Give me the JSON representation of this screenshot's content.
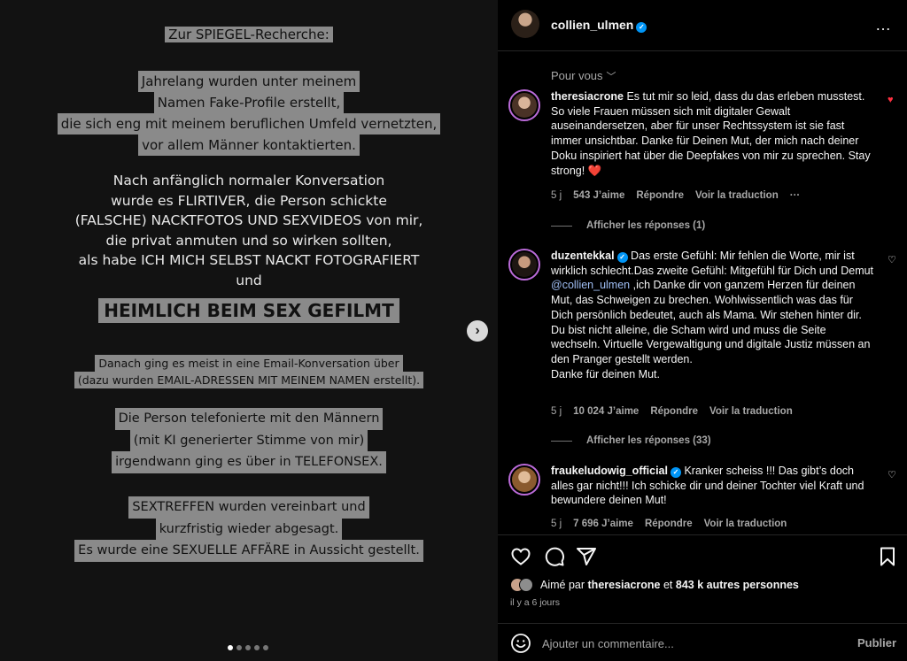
{
  "slide": {
    "title": "Zur SPIEGEL-Recherche:",
    "block_a": [
      "Jahrelang wurden unter meinem",
      "Namen Fake-Profile erstellt,",
      "die sich eng mit meinem beruflichen Umfeld vernetzten,",
      "vor allem Männer kontaktierten."
    ],
    "block_b": [
      "Nach anfänglich normaler Konversation",
      "wurde es FLIRTIVER, die Person schickte",
      "(FALSCHE) NACKTFOTOS UND SEXVIDEOS von mir,",
      "die privat anmuten und so wirken sollten,",
      "als habe ICH MICH SELBST NACKT FOTOGRAFIERT",
      "und"
    ],
    "heimlich": "HEIMLICH BEIM SEX GEFILMT",
    "block_c": [
      "Danach ging es meist in eine Email-Konversation über",
      "(dazu wurden EMAIL-ADRESSEN MIT MEINEM NAMEN erstellt)."
    ],
    "block_d": [
      "Die Person telefonierte mit den Männern",
      "(mit KI generierter Stimme von mir)",
      "irgendwann ging es über in TELEFONSEX."
    ],
    "block_e": [
      "SEXTREFFEN wurden vereinbart und",
      "kurzfristig wieder abgesagt.",
      "Es wurde eine SEXUELLE AFFÄRE in Aussicht gestellt."
    ],
    "dots_total": 5,
    "dots_active": 1
  },
  "header": {
    "username": "collien_ulmen",
    "more_icon": "…"
  },
  "sort": {
    "label": "Pour vous"
  },
  "comments": [
    {
      "username": "theresiacrone",
      "text": "Es tut mir so leid, dass du das erleben musstest. So viele Frauen müssen sich mit digitaler Gewalt auseinandersetzen, aber für unser Rechtssystem ist sie fast immer unsichtbar. Danke für Deinen Mut, der mich nach deiner Doku inspiriert hat über die Deepfakes von mir zu sprechen. Stay strong! ❤️",
      "time": "5 j",
      "likes": "543 J’aime",
      "reply": "Répondre",
      "translate": "Voir la traduction",
      "more": "···",
      "replies": "Afficher les réponses (1)"
    },
    {
      "username": "duzentekkal",
      "text_before": "Das erste Gefühl: Mir fehlen die Worte, mir ist wirklich schlecht.Das zweite Gefühl: Mitgefühl für Dich und Demut ",
      "mention": "@collien_ulmen",
      "text_after": " ,ich Danke dir von ganzem Herzen für deinen Mut, das Schweigen zu brechen. Wohlwissentlich was das für Dich persönlich bedeutet, auch als Mama. Wir stehen hinter dir. Du bist nicht alleine, die Scham wird und muss die Seite wechseln. Virtuelle Vergewaltigung und digitale Justiz müssen an den Pranger gestellt werden.",
      "text_last": "Danke für deinen Mut.",
      "time": "5 j",
      "likes": "10 024 J’aime",
      "reply": "Répondre",
      "translate": "Voir la traduction",
      "replies": "Afficher les réponses (33)"
    },
    {
      "username": "fraukeludowig_official",
      "text": "Kranker scheiss !!! Das gibt’s doch alles gar nicht!!! Ich schicke dir und deiner Tochter viel Kraft und bewundere deinen Mut!",
      "time": "5 j",
      "likes": "7 696 J’aime",
      "reply": "Répondre",
      "translate": "Voir la traduction"
    }
  ],
  "icons": {
    "heart": "♡",
    "heart_filled": "♥",
    "next": "›",
    "sort_chevron": "﹀"
  },
  "likes_summary": {
    "prefix": "Aimé par",
    "user": "theresiacrone",
    "middle": "et",
    "others": "843 k autres personnes"
  },
  "time_ago": "il y a 6 jours",
  "comment_box": {
    "placeholder": "Ajouter un commentaire...",
    "publish": "Publier"
  },
  "colors": {
    "verified": "#0095f6",
    "liked": "#ff3040",
    "mention": "#a0bff5",
    "highlight": "#8a8a8a"
  }
}
